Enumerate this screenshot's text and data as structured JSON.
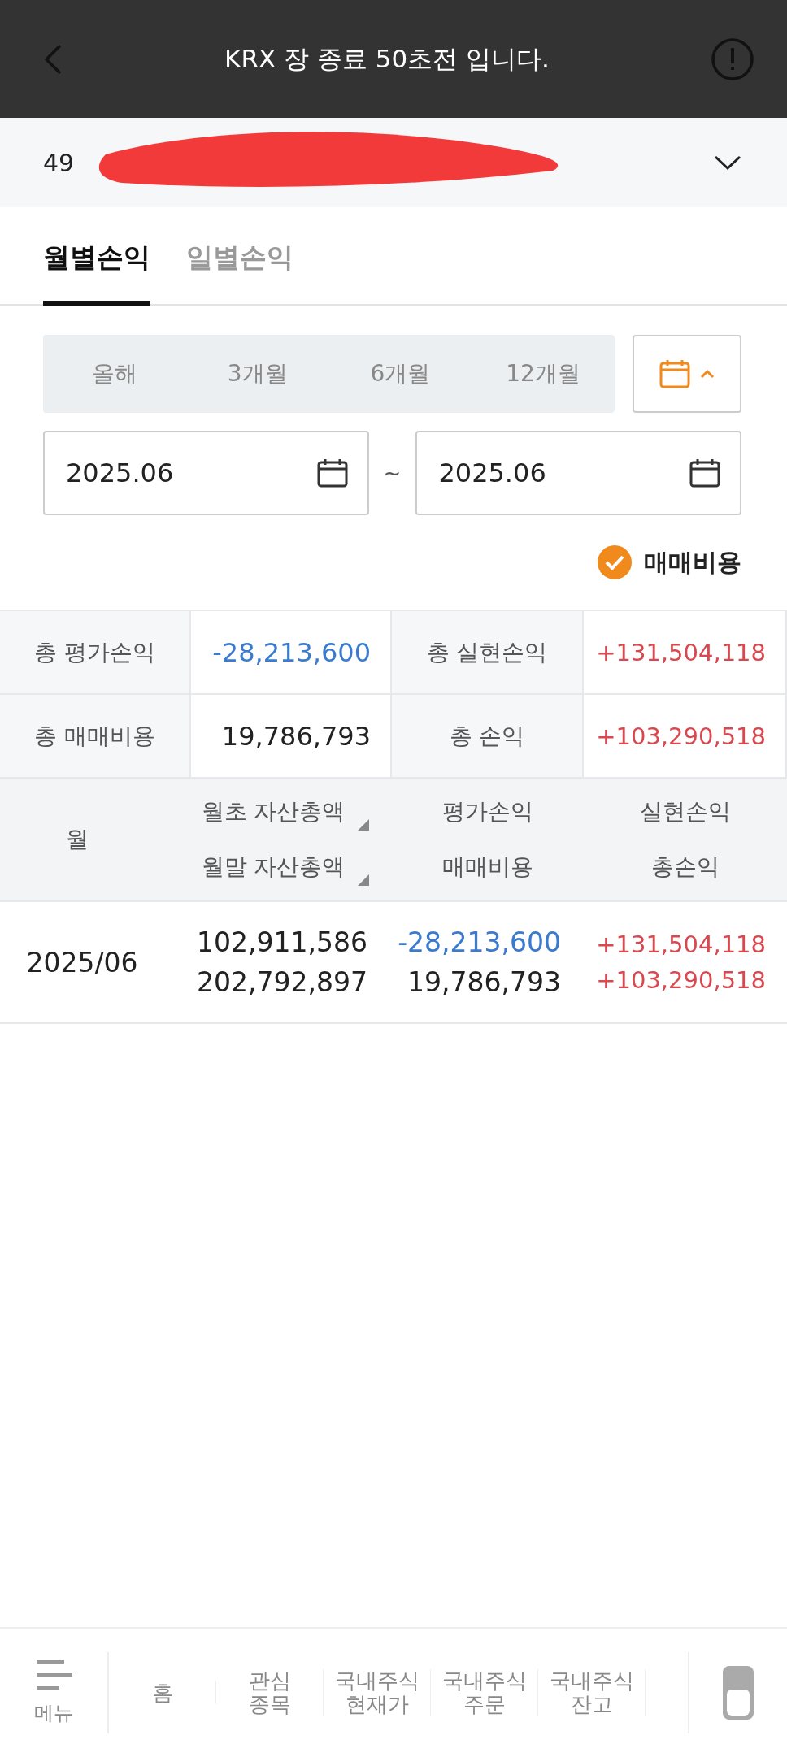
{
  "toast": {
    "text": "KRX 장 종료 50초전 입니다."
  },
  "account": {
    "number": "49"
  },
  "tabs": [
    {
      "label": "월별손익",
      "selected": true
    },
    {
      "label": "일별손익",
      "selected": false
    }
  ],
  "periods": [
    {
      "label": "올해",
      "selected": false
    },
    {
      "label": "3개월",
      "selected": false
    },
    {
      "label": "6개월",
      "selected": false
    },
    {
      "label": "12개월",
      "selected": false
    }
  ],
  "calendar_toggle": {
    "expanded": true
  },
  "date_range": {
    "start": "2025.06",
    "separator": "~",
    "end": "2025.06"
  },
  "trading_cost": {
    "label": "매매비용",
    "checked": true
  },
  "summary": [
    {
      "label": "총 평가손익",
      "value": "-28,213,600",
      "color": "#3a7bd0"
    },
    {
      "label": "총 실현손익",
      "value": "+131,504,118",
      "color": "#d9474f"
    },
    {
      "label": "총 매매비용",
      "value": "19,786,793",
      "color": "#222222"
    },
    {
      "label": "총 손익",
      "value": "+103,290,518",
      "color": "#d9474f"
    }
  ],
  "table": {
    "columns": [
      {
        "lines": [
          "월"
        ],
        "sortable": false
      },
      {
        "lines": [
          "월초 자산총액",
          "월말 자산총액"
        ],
        "sortable": true
      },
      {
        "lines": [
          "평가손익",
          "매매비용"
        ],
        "sortable": false
      },
      {
        "lines": [
          "실현손익",
          "총손익"
        ],
        "sortable": false
      }
    ],
    "rows": [
      {
        "cells": [
          [
            {
              "text": "2025/06",
              "color": "#222222"
            }
          ],
          [
            {
              "text": "102,911,586",
              "color": "#222222"
            },
            {
              "text": "202,792,897",
              "color": "#222222"
            }
          ],
          [
            {
              "text": "-28,213,600",
              "color": "#3a7bd0"
            },
            {
              "text": "19,786,793",
              "color": "#222222"
            }
          ],
          [
            {
              "text": "+131,504,118",
              "color": "#d9474f"
            },
            {
              "text": "+103,290,518",
              "color": "#d9474f"
            }
          ]
        ]
      }
    ]
  },
  "bottom_nav": [
    {
      "kind": "menu",
      "lines": [
        "메뉴"
      ]
    },
    {
      "kind": "text",
      "lines": [
        "홈"
      ]
    },
    {
      "kind": "text",
      "lines": [
        "관심",
        "종목"
      ]
    },
    {
      "kind": "text",
      "lines": [
        "국내주식",
        "현재가"
      ]
    },
    {
      "kind": "text",
      "lines": [
        "국내주식",
        "주문"
      ]
    },
    {
      "kind": "text",
      "lines": [
        "국내주식",
        "잔고"
      ]
    },
    {
      "kind": "toggle"
    }
  ]
}
